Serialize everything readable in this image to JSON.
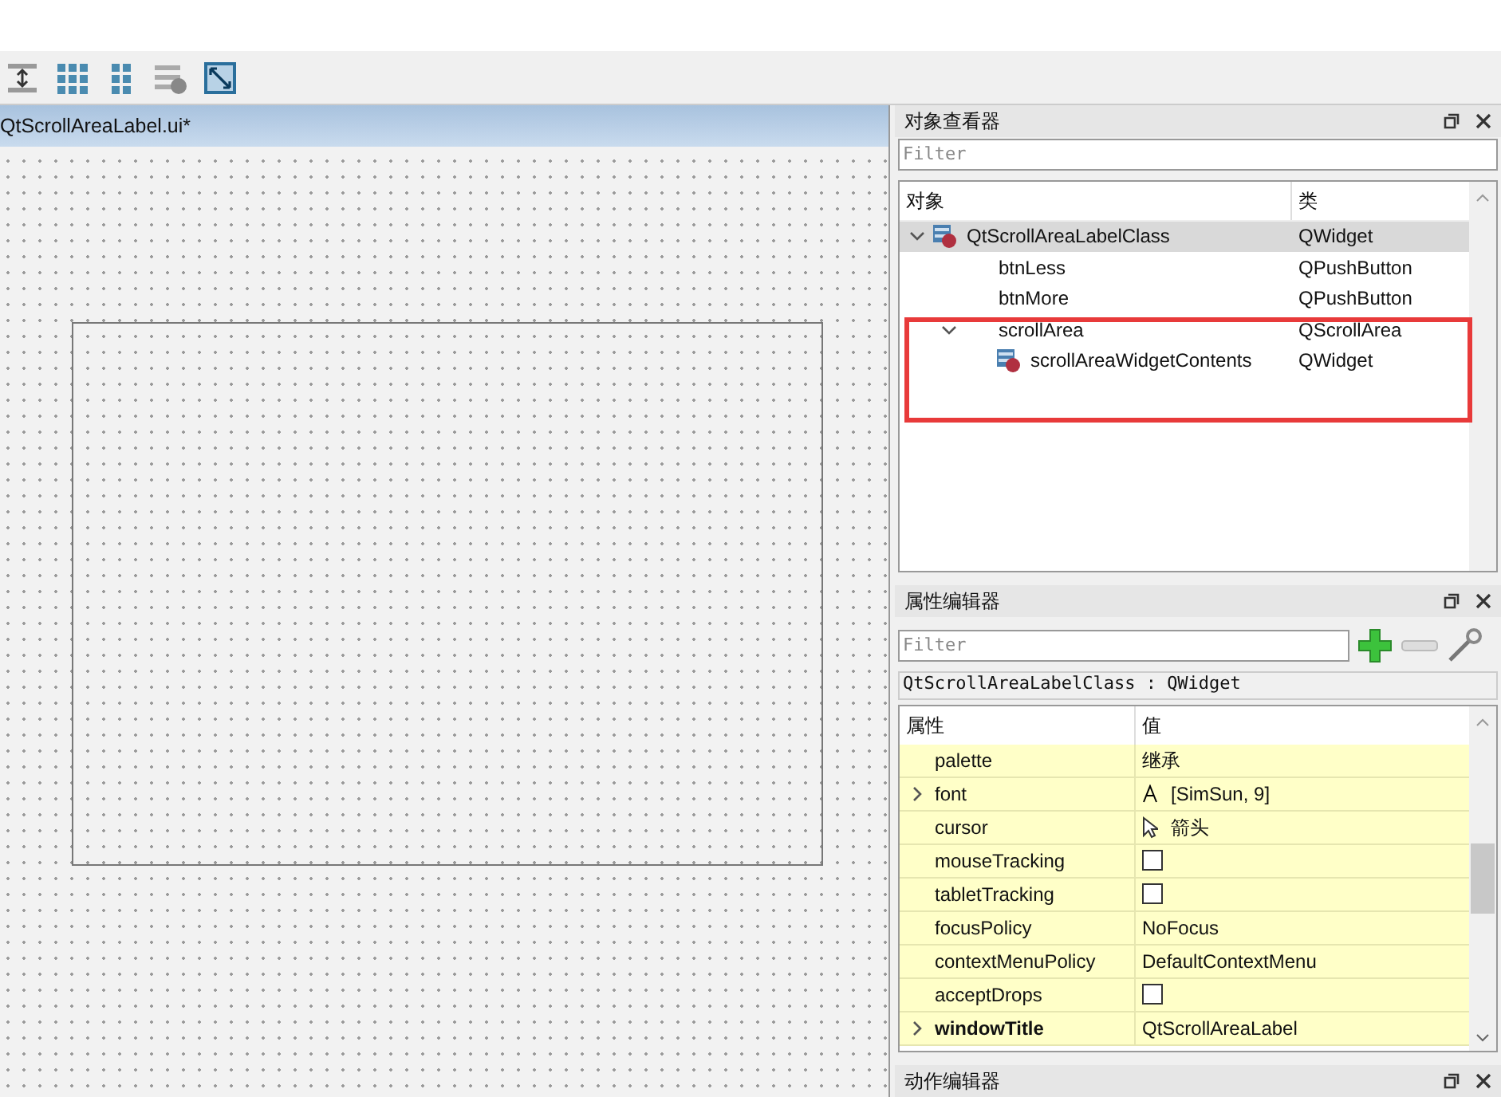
{
  "form_window": {
    "title": "QtScrollAreaLabel.ui*"
  },
  "object_inspector": {
    "title": "对象查看器",
    "filter": {
      "placeholder": "Filter"
    },
    "columns": [
      "对象",
      "类"
    ],
    "tree": [
      {
        "name": "QtScrollAreaLabelClass",
        "class": "QWidget",
        "kind": "widget",
        "selected": true,
        "expanded": true,
        "children": [
          {
            "name": "btnLess",
            "class": "QPushButton",
            "selected": false
          },
          {
            "name": "btnMore",
            "class": "QPushButton",
            "selected": false
          },
          {
            "name": "scrollArea",
            "class": "QScrollArea",
            "selected": false,
            "expanded": true,
            "children": [
              {
                "name": "scrollAreaWidgetContents",
                "class": "QWidget",
                "kind": "widget",
                "selected": false
              }
            ]
          }
        ]
      }
    ]
  },
  "property_editor": {
    "title": "属性编辑器",
    "filter": {
      "placeholder": "Filter"
    },
    "object_label": "QtScrollAreaLabelClass : QWidget",
    "columns": [
      "属性",
      "值"
    ],
    "rows": [
      {
        "name": "palette",
        "kind": "text",
        "value": "继承",
        "collapsible": false,
        "modified": false
      },
      {
        "name": "font",
        "kind": "font",
        "value": "[SimSun, 9]",
        "collapsible": true,
        "modified": false
      },
      {
        "name": "cursor",
        "kind": "cursor",
        "value": "箭头",
        "collapsible": false,
        "modified": false
      },
      {
        "name": "mouseTracking",
        "kind": "checkbox",
        "checked": false,
        "collapsible": false,
        "modified": false
      },
      {
        "name": "tabletTracking",
        "kind": "checkbox",
        "checked": false,
        "collapsible": false,
        "modified": false
      },
      {
        "name": "focusPolicy",
        "kind": "text",
        "value": "NoFocus",
        "collapsible": false,
        "modified": false
      },
      {
        "name": "contextMenuPolicy",
        "kind": "text",
        "value": "DefaultContextMenu",
        "collapsible": false,
        "modified": false
      },
      {
        "name": "acceptDrops",
        "kind": "checkbox",
        "checked": false,
        "collapsible": false,
        "modified": false
      },
      {
        "name": "windowTitle",
        "kind": "text",
        "value": "QtScrollAreaLabel",
        "collapsible": true,
        "modified": true
      }
    ]
  },
  "action_editor": {
    "title": "动作编辑器"
  }
}
